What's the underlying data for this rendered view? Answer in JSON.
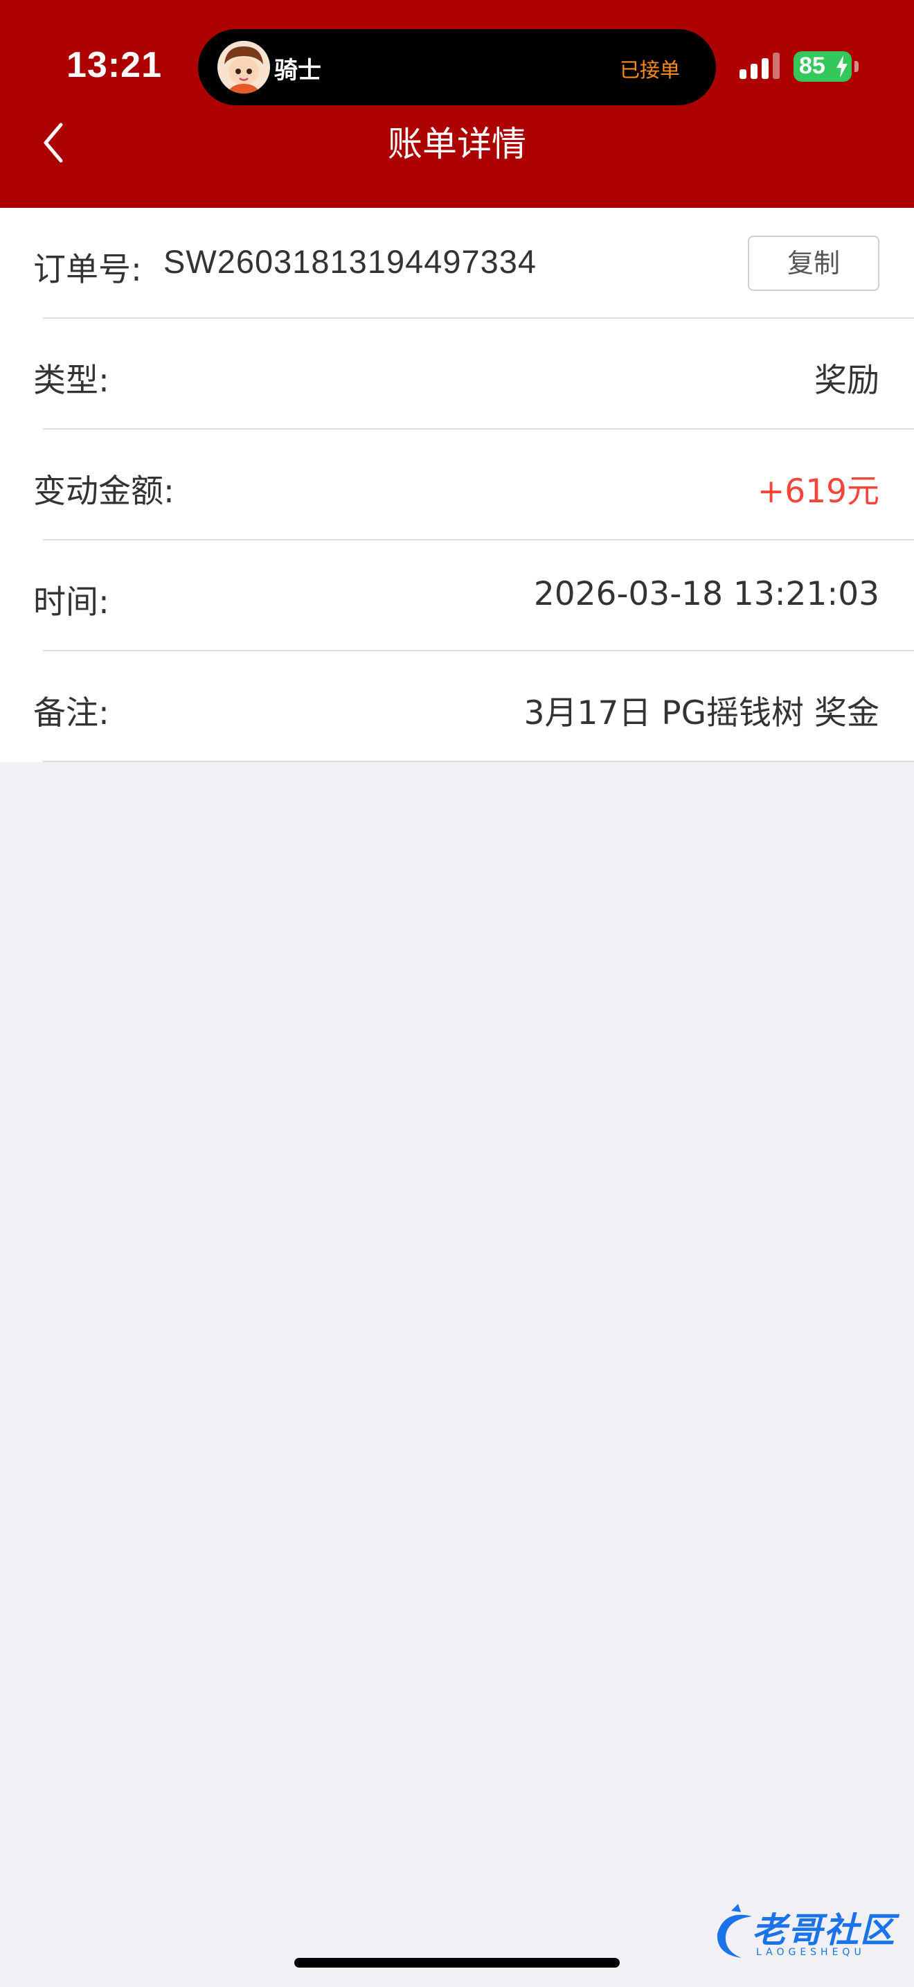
{
  "status_bar": {
    "time": "13:21",
    "battery": "85"
  },
  "live_activity": {
    "name": "骑士",
    "status": "已接单"
  },
  "nav": {
    "title": "账单详情"
  },
  "order": {
    "label": "订单号:",
    "number": "SW26031813194497334",
    "copy_label": "复制"
  },
  "rows": [
    {
      "label": "类型:",
      "value": "奖励"
    },
    {
      "label": "变动金额:",
      "value": "+619元"
    },
    {
      "label": "时间:",
      "value": "2026-03-18 13:21:03"
    },
    {
      "label": "备注:",
      "value": "3月17日 PG摇钱树 奖金"
    }
  ],
  "watermark": {
    "text": "老哥社区",
    "sub": "LAOGESHEQU"
  },
  "colors": {
    "header": "#ad0000",
    "amount": "#f5453a",
    "island_status": "#ff8a1e",
    "battery": "#34c759",
    "page_bg": "#f0f0f5"
  }
}
